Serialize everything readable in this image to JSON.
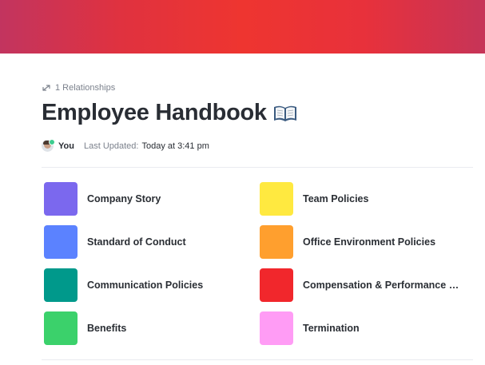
{
  "banner": {
    "gradient": [
      "#c2345f",
      "#ee3530",
      "#c63458"
    ]
  },
  "relationships": {
    "icon": "relationship-icon",
    "label": "1 Relationships"
  },
  "doc": {
    "title": "Employee Handbook",
    "title_icon": "open-book-icon"
  },
  "meta": {
    "author": "You",
    "updated_label": "Last Updated:",
    "updated_value": "Today at 3:41 pm"
  },
  "pages": [
    {
      "label": "Company Story",
      "color": "#7b68ee"
    },
    {
      "label": "Team Policies",
      "color": "#ffe940"
    },
    {
      "label": "Standard of Conduct",
      "color": "#5b82ff"
    },
    {
      "label": "Office Environment Policies",
      "color": "#ff9f2e"
    },
    {
      "label": "Communication Policies",
      "color": "#00998b"
    },
    {
      "label": "Compensation & Performance Re...",
      "color": "#f1272c"
    },
    {
      "label": "Benefits",
      "color": "#3bd16b"
    },
    {
      "label": "Termination",
      "color": "#ff9cf5"
    }
  ]
}
